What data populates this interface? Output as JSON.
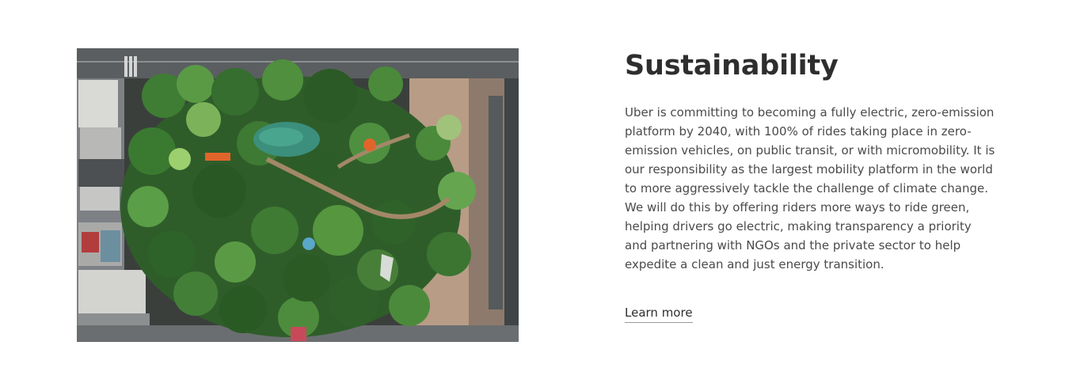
{
  "section": {
    "title": "Sustainability",
    "body": "Uber is committing to becoming a fully electric, zero-emission platform by 2040, with 100% of rides taking place in zero-emission vehicles, on public transit, or with micromobility. It is our responsibility as the largest mobility platform in the world to more aggressively tackle the challenge of climate change. We will do this by offering riders more ways to ride green, helping drivers go electric, making transparency a priority and partnering with NGOs and the private sector to help expedite a clean and just energy transition.",
    "link_label": "Learn more"
  },
  "image": {
    "icon": "aerial-park-photo"
  }
}
